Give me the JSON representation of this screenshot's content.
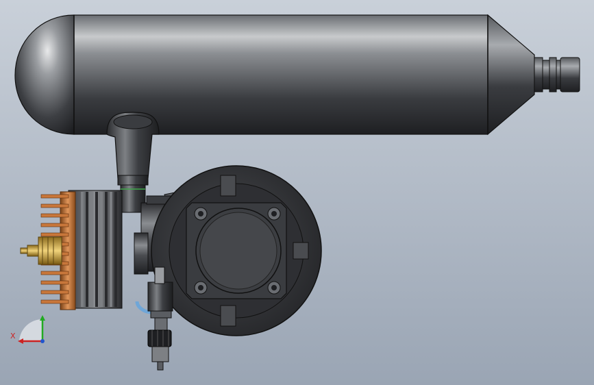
{
  "viewport": {
    "background_top": "#c9d0d9",
    "background_bottom": "#9aa5b4"
  },
  "model": {
    "parts": [
      "muffler-tank",
      "exhaust-pipe",
      "cylinder-head-fins",
      "cylinder-barrel",
      "crankcase",
      "backplate-cover",
      "spark-plug",
      "carburetor",
      "needle-valve"
    ],
    "colors": {
      "metal_dark": "#2b2d30",
      "metal_mid": "#5a5d62",
      "metal_light": "#a7aaae",
      "copper": "#c8773b",
      "brass": "#d4b25a",
      "blue_fitting": "#6fa6d8",
      "edge": "#111111"
    }
  },
  "triad": {
    "x_label": "X",
    "x_color": "#cc2222",
    "y_color": "#22aa22",
    "z_color": "#2255cc"
  }
}
